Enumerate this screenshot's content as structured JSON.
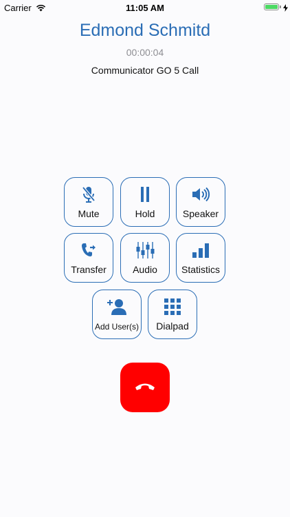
{
  "status_bar": {
    "carrier": "Carrier",
    "time": "11:05 AM"
  },
  "call": {
    "name": "Edmond Schmitd",
    "duration": "00:00:04",
    "type": "Communicator GO 5 Call"
  },
  "controls": {
    "mute": "Mute",
    "hold": "Hold",
    "speaker": "Speaker",
    "transfer": "Transfer",
    "audio": "Audio",
    "statistics": "Statistics",
    "add_users": "Add User(s)",
    "dialpad": "Dialpad"
  },
  "colors": {
    "accent": "#2a6db5",
    "hangup": "#ff0000"
  },
  "icons": {
    "mute": "mic-off-icon",
    "hold": "pause-icon",
    "speaker": "speaker-icon",
    "transfer": "phone-forward-icon",
    "audio": "equalizer-icon",
    "statistics": "signal-bars-icon",
    "add_users": "add-user-icon",
    "dialpad": "dialpad-grid-icon",
    "hangup": "end-call-icon"
  }
}
